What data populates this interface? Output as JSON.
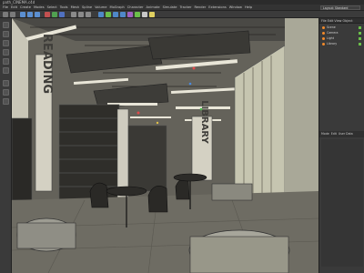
{
  "window": {
    "title": "path_CINEMA.c4d"
  },
  "menu": {
    "items": [
      "File",
      "Edit",
      "Create",
      "Modes",
      "Select",
      "Tools",
      "Mesh",
      "Spline",
      "Volume",
      "MoGraph",
      "Character",
      "Animate",
      "Simulate",
      "Tracker",
      "Render",
      "Extensions",
      "Window",
      "Help"
    ],
    "layout_label": "Layout: Standard"
  },
  "objects_panel": {
    "tabs_label": "File  Edit  View  Object",
    "rows": [
      {
        "name": "Scene"
      },
      {
        "name": "Camera"
      },
      {
        "name": "Light"
      },
      {
        "name": "Library"
      }
    ]
  },
  "attributes_panel": {
    "tabs": [
      "Mode",
      "Edit",
      "User Data"
    ]
  },
  "scene": {
    "sign_left": "READING",
    "sign_right": "LIBRARY"
  },
  "colors": {
    "accent": "#f28a2a",
    "viewport_bg": "#64625a",
    "ui_dark": "#3a3a3a",
    "status_green": "#6bbf4a"
  }
}
